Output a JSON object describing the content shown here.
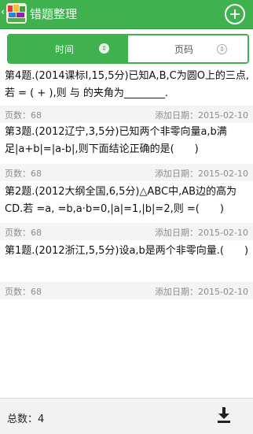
{
  "header": {
    "title": "错题整理",
    "back_icon": "chevron-left-icon",
    "app_icon": "app-logo-icon",
    "add_icon": "plus-circle-icon",
    "color": "#3fb24f"
  },
  "tabs": [
    {
      "label": "时间",
      "icon": "sort-icon",
      "active": true
    },
    {
      "label": "页码",
      "icon": "sort-icon",
      "active": false
    }
  ],
  "questions": [
    {
      "text": "第4题.(2014课标Ⅰ,15,5分)已知A,B,C为圆O上的三点,若 = ( + ),则 与 的夹角为________.",
      "pages": "页数：68",
      "date": "添加日期：2015-02-10"
    },
    {
      "text": "第3题.(2012辽宁,3,5分)已知两个非零向量a,b满足|a+b|=|a-b|,则下面结论正确的是(　　)",
      "pages": "页数：68",
      "date": "添加日期：2015-02-10"
    },
    {
      "text": "第2题.(2012大纲全国,6,5分)△ABC中,AB边的高为CD.若 =a, =b,a·b=0,|a|=1,|b|=2,则 =(　　)",
      "pages": "页数：68",
      "date": "添加日期：2015-02-10"
    },
    {
      "text": "第1题.(2012浙江,5,5分)设a,b是两个非零向量.(　　)",
      "pages": "页数：68",
      "date": "添加日期：2015-02-10"
    }
  ],
  "footer": {
    "total": "总数：4",
    "download_icon": "download-icon"
  }
}
